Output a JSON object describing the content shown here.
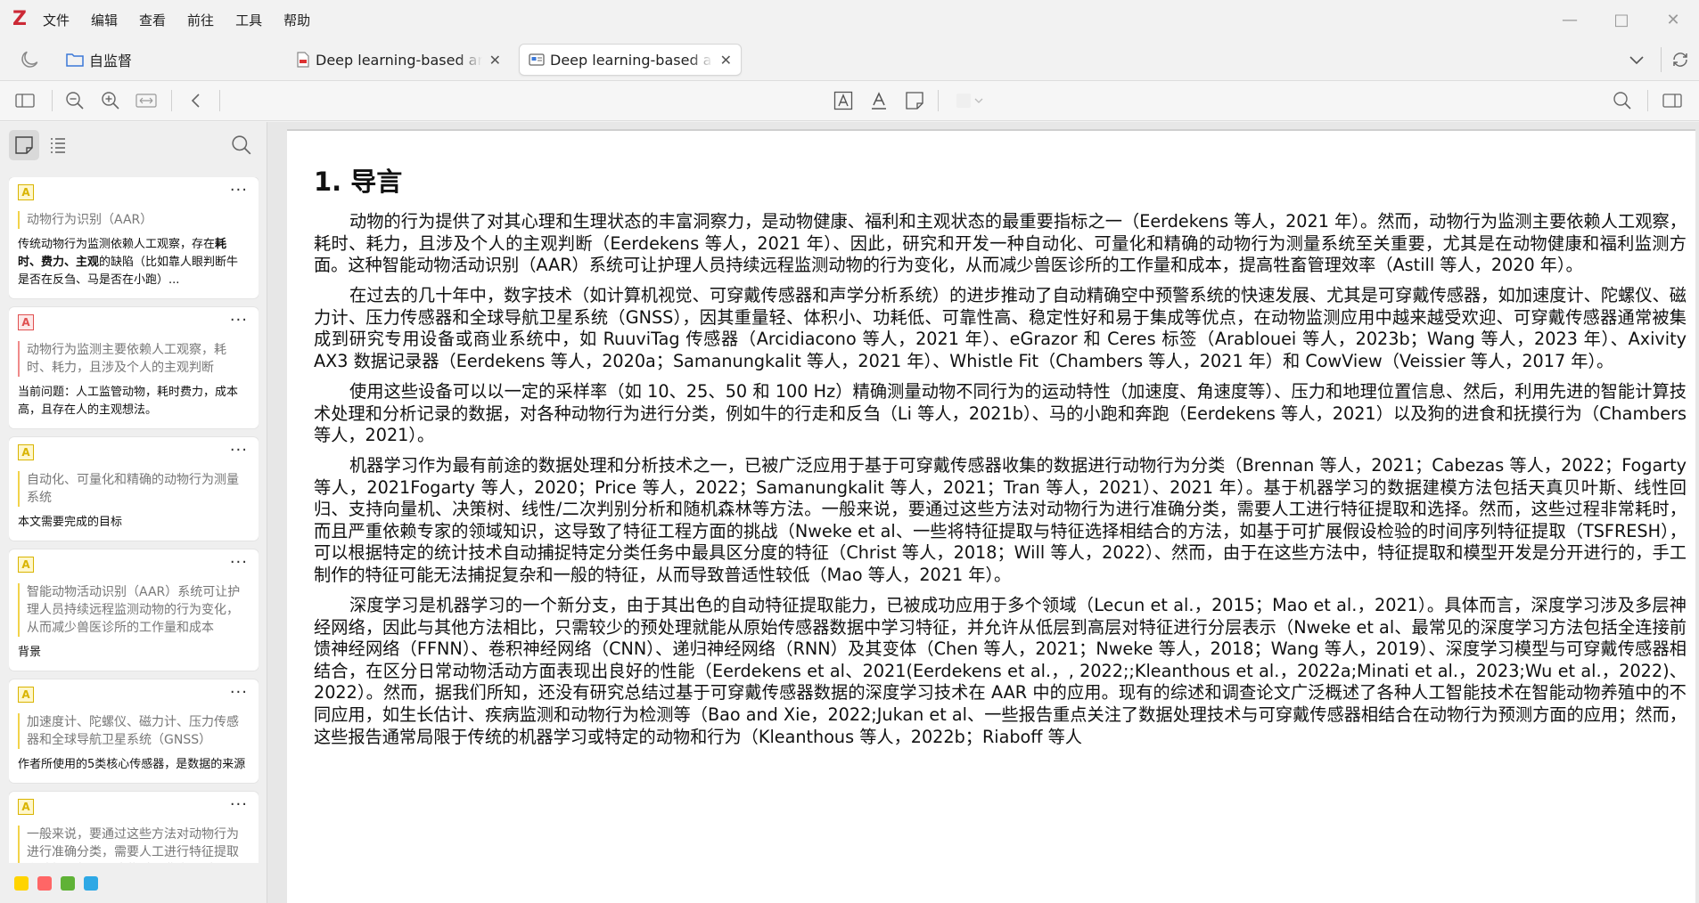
{
  "app": {
    "logo": "Z",
    "menu": [
      "文件",
      "编辑",
      "查看",
      "前往",
      "工具",
      "帮助"
    ],
    "window_controls": [
      "minimize-icon",
      "maximize-icon",
      "close-icon"
    ]
  },
  "tabs": {
    "library_label": "自监督",
    "docs": [
      {
        "label": "Deep learning-based animal",
        "icon": "pdf-icon",
        "active": false
      },
      {
        "label": "Deep learning-based animal",
        "icon": "reader-icon",
        "active": true
      }
    ]
  },
  "sidebar": {
    "cards": [
      {
        "color": "yellow",
        "quote": "动物行为识别（AAR）",
        "comment_html": "传统动物行为监测依赖人工观察，存在<b>耗时、费力、主观</b>的缺陷（比如靠人眼判断牛是否在反刍、马是否在小跑）..."
      },
      {
        "color": "red",
        "quote": "动物行为监测主要依赖人工观察，耗时、耗力，且涉及个人的主观判断",
        "comment_html": "当前问题：人工监管动物，耗时费力，成本高，且存在人的主观想法。"
      },
      {
        "color": "yellow",
        "quote": "自动化、可量化和精确的动物行为测量系统",
        "comment_html": "本文需要完成的目标"
      },
      {
        "color": "yellow",
        "quote": "智能动物活动识别（AAR）系统可让护理人员持续远程监测动物的行为变化，从而减少兽医诊所的工作量和成本",
        "comment_html": "背景"
      },
      {
        "color": "yellow",
        "quote": "加速度计、陀螺仪、磁力计、压力传感器和全球导航卫星系统（GNSS）",
        "comment_html": "作者所使用的5类核心传感器，是数据的来源"
      },
      {
        "color": "yellow",
        "quote": "一般来说，要通过这些方法对动物行为进行准确分类，需要人工进行特征提取和选择。然而，这些过程非常耗时",
        "comment_html": ""
      }
    ],
    "swatches": [
      "#ffd400",
      "#ff6666",
      "#5fb236",
      "#2ea8e5"
    ]
  },
  "document": {
    "heading": "1. 导言",
    "paragraphs": [
      "动物的行为提供了对其心理和生理状态的丰富洞察力，是动物健康、福利和主观状态的最重要指标之一（Eerdekens 等人，2021 年）。然而，动物行为监测主要依赖人工观察，耗时、耗力，且涉及个人的主观判断（Eerdekens 等人，2021 年）、因此，研究和开发一种自动化、可量化和精确的动物行为测量系统至关重要，尤其是在动物健康和福利监测方面。这种智能动物活动识别（AAR）系统可让护理人员持续远程监测动物的行为变化，从而减少兽医诊所的工作量和成本，提高牲畜管理效率（Astill 等人，2020 年）。",
      "在过去的几十年中，数字技术（如计算机视觉、可穿戴传感器和声学分析系统）的进步推动了自动精确空中预警系统的快速发展、尤其是可穿戴传感器，如加速度计、陀螺仪、磁力计、压力传感器和全球导航卫星系统（GNSS），因其重量轻、体积小、功耗低、可靠性高、稳定性好和易于集成等优点，在动物监测应用中越来越受欢迎、可穿戴传感器通常被集成到研究专用设备或商业系统中，如 RuuviTag 传感器（Arcidiacono 等人，2021 年）、eGrazor 和 Ceres 标签（Arablouei 等人，2023b；Wang 等人，2023 年）、Axivity AX3 数据记录器（Eerdekens 等人，2020a；Samanungkalit 等人，2021 年）、Whistle Fit（Chambers 等人，2021 年）和 CowView（Veissier 等人，2017 年）。",
      "使用这些设备可以以一定的采样率（如 10、25、50 和 100 Hz）精确测量动物不同行为的运动特性（加速度、角速度等）、压力和地理位置信息、然后，利用先进的智能计算技术处理和分析记录的数据，对各种动物行为进行分类，例如牛的行走和反刍（Li 等人，2021b）、马的小跑和奔跑（Eerdekens 等人，2021）以及狗的进食和抚摸行为（Chambers 等人，2021）。",
      "机器学习作为最有前途的数据处理和分析技术之一，已被广泛应用于基于可穿戴传感器收集的数据进行动物行为分类（Brennan 等人，2021；Cabezas 等人，2022；Fogarty 等人，2021Fogarty 等人，2020；Price 等人，2022；Samanungkalit 等人，2021；Tran 等人，2021）、2021 年）。基于机器学习的数据建模方法包括天真贝叶斯、线性回归、支持向量机、决策树、线性/二次判别分析和随机森林等方法。一般来说，要通过这些方法对动物行为进行准确分类，需要人工进行特征提取和选择。然而，这些过程非常耗时，而且严重依赖专家的领域知识，这导致了特征工程方面的挑战（Nweke et al、一些将特征提取与特征选择相结合的方法，如基于可扩展假设检验的时间序列特征提取（TSFRESH），可以根据特定的统计技术自动捕捉特定分类任务中最具区分度的特征（Christ 等人，2018；Will 等人，2022）、然而，由于在这些方法中，特征提取和模型开发是分开进行的，手工制作的特征可能无法捕捉复杂和一般的特征，从而导致普适性较低（Mao 等人，2021 年）。",
      "深度学习是机器学习的一个新分支，由于其出色的自动特征提取能力，已被成功应用于多个领域（Lecun et al.，2015；Mao et al.，2021）。具体而言，深度学习涉及多层神经网络，因此与其他方法相比，只需较少的预处理就能从原始传感器数据中学习特征，并允许从低层到高层对特征进行分层表示（Nweke et al、最常见的深度学习方法包括全连接前馈神经网络（FFNN）、卷积神经网络（CNN）、递归神经网络（RNN）及其变体（Chen 等人，2021；Nweke 等人，2018；Wang 等人，2019）、深度学习模型与可穿戴传感器相结合，在区分日常动物活动方面表现出良好的性能（Eerdekens et al、2021(Eerdekens et al.，, 2022;;Kleanthous et al.，2022a;Minati et al.，2023;Wu et al.，2022)、2022）。然而，据我们所知，还没有研究总结过基于可穿戴传感器数据的深度学习技术在 AAR 中的应用。现有的综述和调查论文广泛概述了各种人工智能技术在智能动物养殖中的不同应用，如生长估计、疾病监测和动物行为检测等（Bao and Xie，2022;Jukan et al、一些报告重点关注了数据处理技术与可穿戴传感器相结合在动物行为预测方面的应用；然而，这些报告通常局限于传统的机器学习或特定的动物和行为（Kleanthous 等人，2022b；Riaboff 等人"
    ]
  }
}
